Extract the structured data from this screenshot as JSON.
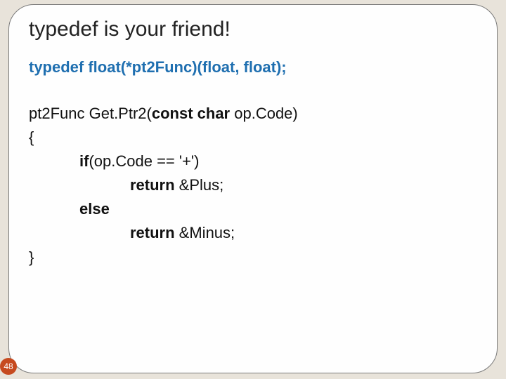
{
  "slide": {
    "title": "typedef is your friend!",
    "typedef_line": "typedef float(*pt2Func)(float, float);",
    "code": {
      "l1a": "pt2Func Get.Ptr2(",
      "l1b": "const char",
      "l1c": " op.Code)",
      "l2": "{",
      "l3a": "if",
      "l3b": "(op.Code == '+')",
      "l4a": "return",
      "l4b": " &Plus;",
      "l5": "else",
      "l6a": "return",
      "l6b": " &Minus;",
      "l7": "}"
    },
    "number": "48"
  }
}
